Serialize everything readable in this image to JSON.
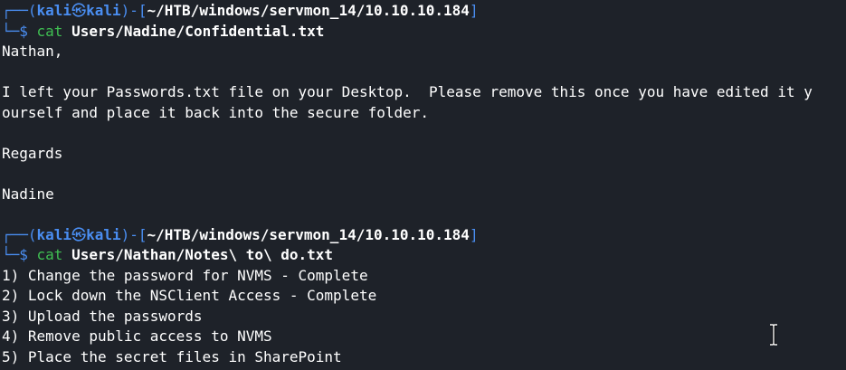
{
  "theme": {
    "background": "#1e2229",
    "prompt_color": "#4a8ef2",
    "command_color": "#3fbf52",
    "text_color": "#ffffff"
  },
  "blocks": [
    {
      "prompt": {
        "user": "kali",
        "host": "kali",
        "symbol": "㉿",
        "cwd": "~/HTB/windows/servmon_14/10.10.10.184"
      },
      "command": "cat",
      "argument": "Users/Nadine/Confidential.txt",
      "output": [
        "Nathan,",
        "",
        "I left your Passwords.txt file on your Desktop.  Please remove this once you have edited it y",
        "ourself and place it back into the secure folder.",
        "",
        "Regards",
        "",
        "Nadine",
        ""
      ]
    },
    {
      "prompt": {
        "user": "kali",
        "host": "kali",
        "symbol": "㉿",
        "cwd": "~/HTB/windows/servmon_14/10.10.10.184"
      },
      "command": "cat",
      "argument": "Users/Nathan/Notes\\ to\\ do.txt",
      "output": [
        "1) Change the password for NVMS - Complete",
        "2) Lock down the NSClient Access - Complete",
        "3) Upload the passwords",
        "4) Remove public access to NVMS",
        "5) Place the secret files in SharePoint"
      ]
    }
  ],
  "cursor_icon": "text-ibeam-cursor-icon"
}
